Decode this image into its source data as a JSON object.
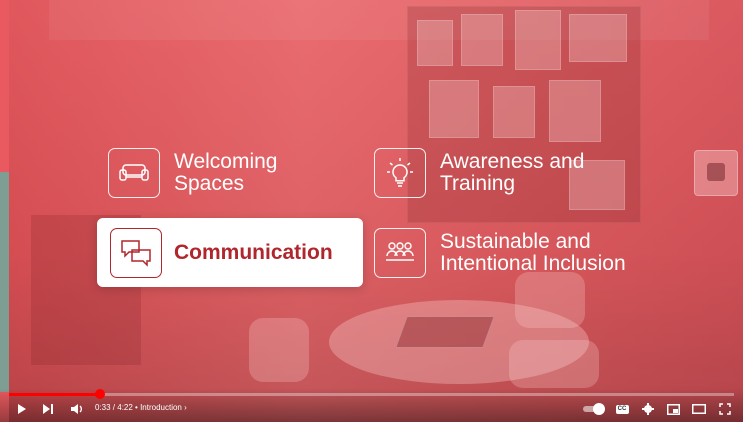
{
  "video": {
    "items": [
      {
        "label": "Welcoming\nSpaces",
        "icon": "sofa-icon"
      },
      {
        "label": "Awareness and\nTraining",
        "icon": "lightbulb-icon"
      },
      {
        "label": "Communication",
        "icon": "speech-bubbles-icon",
        "highlighted": true
      },
      {
        "label": "Sustainable and\nIntentional Inclusion",
        "icon": "people-group-icon"
      }
    ],
    "overlay_color": "#e85a5f",
    "highlight_text_color": "#b0262d"
  },
  "player": {
    "current_time": "0:33",
    "separator": " / ",
    "duration": "4:22",
    "chapter_bullet": " • ",
    "chapter": "Introduction",
    "chapter_chevron": "›",
    "progress_fraction": 0.126,
    "progress_color": "#ff0000",
    "cc_label": "CC"
  }
}
